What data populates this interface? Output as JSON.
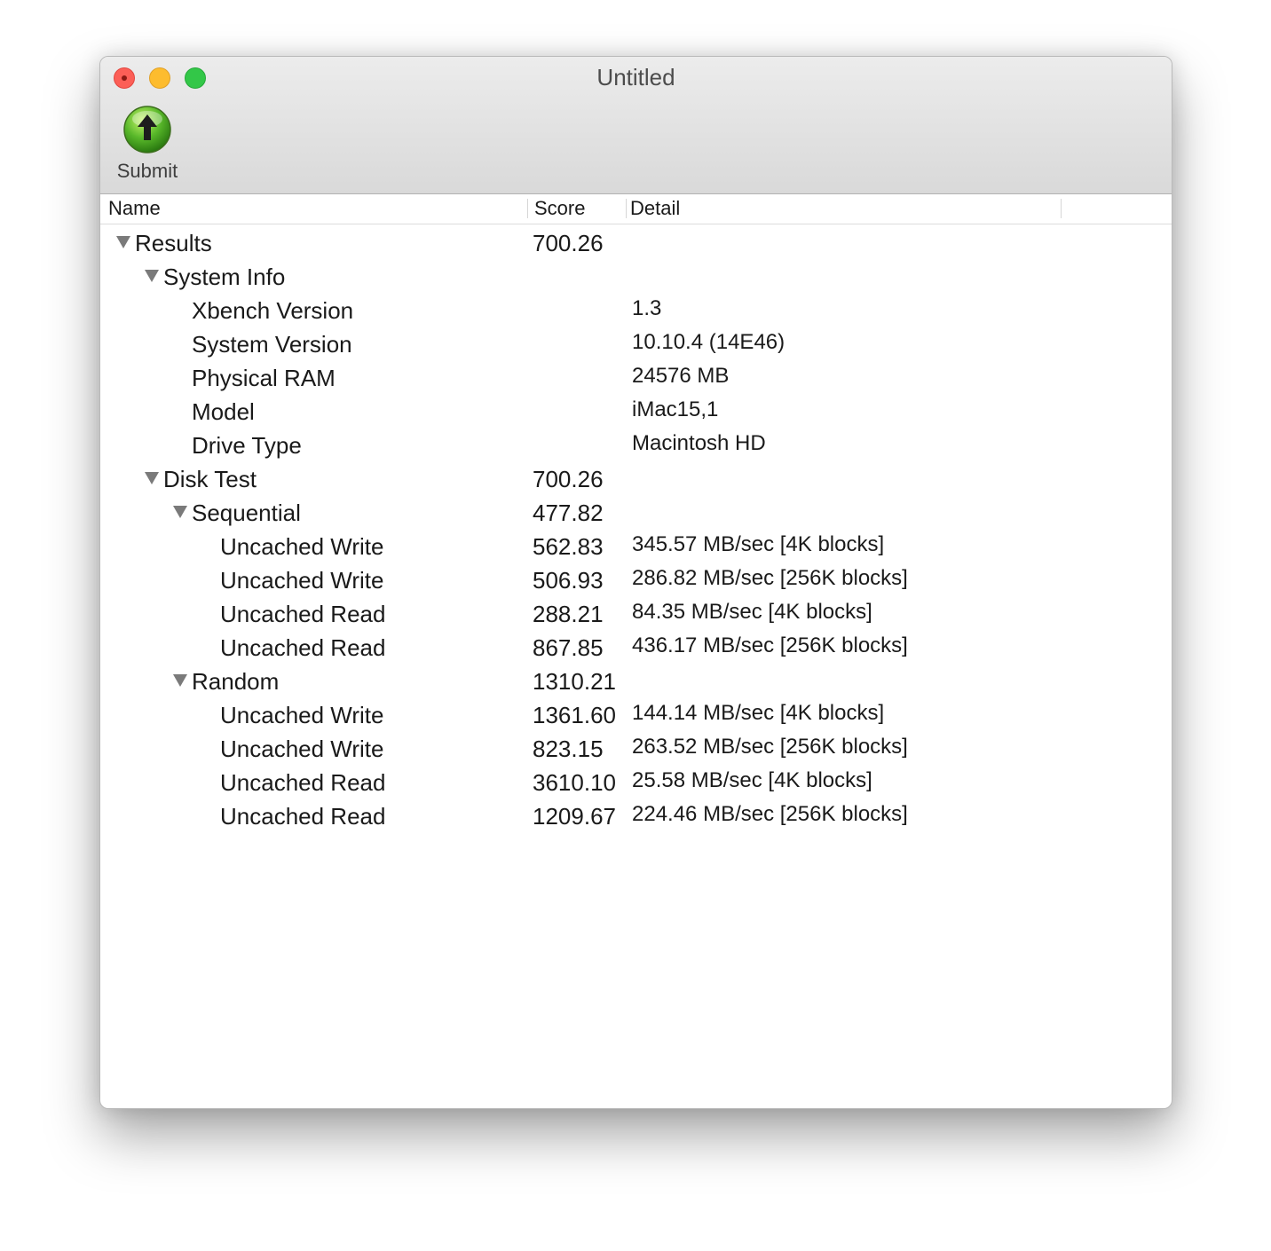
{
  "window": {
    "title": "Untitled"
  },
  "toolbar": {
    "submit_label": "Submit",
    "submit_icon": "green-up-arrow-icon"
  },
  "columns": {
    "name": "Name",
    "score": "Score",
    "detail": "Detail"
  },
  "rows": [
    {
      "name": "Results",
      "score": "700.26",
      "detail": "",
      "depth": 0,
      "expandable": true
    },
    {
      "name": "System Info",
      "score": "",
      "detail": "",
      "depth": 1,
      "expandable": true
    },
    {
      "name": "Xbench Version",
      "score": "",
      "detail": "1.3",
      "depth": 2,
      "expandable": false
    },
    {
      "name": "System Version",
      "score": "",
      "detail": "10.10.4 (14E46)",
      "depth": 2,
      "expandable": false
    },
    {
      "name": "Physical RAM",
      "score": "",
      "detail": "24576 MB",
      "depth": 2,
      "expandable": false
    },
    {
      "name": "Model",
      "score": "",
      "detail": "iMac15,1",
      "depth": 2,
      "expandable": false
    },
    {
      "name": "Drive Type",
      "score": "",
      "detail": "Macintosh HD",
      "depth": 2,
      "expandable": false
    },
    {
      "name": "Disk Test",
      "score": "700.26",
      "detail": "",
      "depth": 1,
      "expandable": true
    },
    {
      "name": "Sequential",
      "score": "477.82",
      "detail": "",
      "depth": 2,
      "expandable": true
    },
    {
      "name": "Uncached Write",
      "score": "562.83",
      "detail": "345.57 MB/sec [4K blocks]",
      "depth": 3,
      "expandable": false
    },
    {
      "name": "Uncached Write",
      "score": "506.93",
      "detail": "286.82 MB/sec [256K blocks]",
      "depth": 3,
      "expandable": false
    },
    {
      "name": "Uncached Read",
      "score": "288.21",
      "detail": "84.35 MB/sec [4K blocks]",
      "depth": 3,
      "expandable": false
    },
    {
      "name": "Uncached Read",
      "score": "867.85",
      "detail": "436.17 MB/sec [256K blocks]",
      "depth": 3,
      "expandable": false
    },
    {
      "name": "Random",
      "score": "1310.21",
      "detail": "",
      "depth": 2,
      "expandable": true
    },
    {
      "name": "Uncached Write",
      "score": "1361.60",
      "detail": "144.14 MB/sec [4K blocks]",
      "depth": 3,
      "expandable": false
    },
    {
      "name": "Uncached Write",
      "score": "823.15",
      "detail": "263.52 MB/sec [256K blocks]",
      "depth": 3,
      "expandable": false
    },
    {
      "name": "Uncached Read",
      "score": "3610.10",
      "detail": "25.58 MB/sec [4K blocks]",
      "depth": 3,
      "expandable": false
    },
    {
      "name": "Uncached Read",
      "score": "1209.67",
      "detail": "224.46 MB/sec [256K blocks]",
      "depth": 3,
      "expandable": false
    }
  ]
}
